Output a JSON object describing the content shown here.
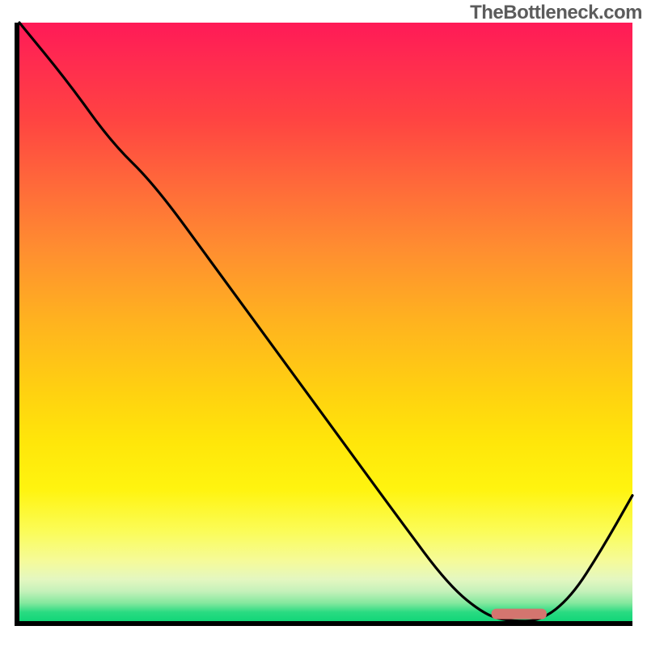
{
  "watermark": "TheBottleneck.com",
  "chart_data": {
    "type": "line",
    "title": "",
    "xlabel": "",
    "ylabel": "",
    "xlim": [
      0,
      100
    ],
    "ylim": [
      0,
      100
    ],
    "grid": false,
    "legend": false,
    "background": {
      "type": "vertical-gradient",
      "stops": [
        {
          "pct": 0,
          "color": "#ff1a57"
        },
        {
          "pct": 50,
          "color": "#ffb31f"
        },
        {
          "pct": 78,
          "color": "#fff40f"
        },
        {
          "pct": 100,
          "color": "#11d678"
        }
      ]
    },
    "series": [
      {
        "name": "bottleneck-curve",
        "x": [
          0,
          8,
          15,
          22,
          32,
          42,
          52,
          62,
          70,
          76,
          80,
          85,
          90,
          95,
          100
        ],
        "y": [
          100,
          90,
          80,
          73,
          59,
          45,
          31,
          17,
          6,
          1,
          0,
          0,
          4,
          12,
          21
        ]
      }
    ],
    "annotations": [
      {
        "name": "optimal-marker",
        "shape": "rounded-rect",
        "x_range": [
          77,
          86
        ],
        "y": 1.2,
        "color": "#d4756f"
      }
    ]
  }
}
